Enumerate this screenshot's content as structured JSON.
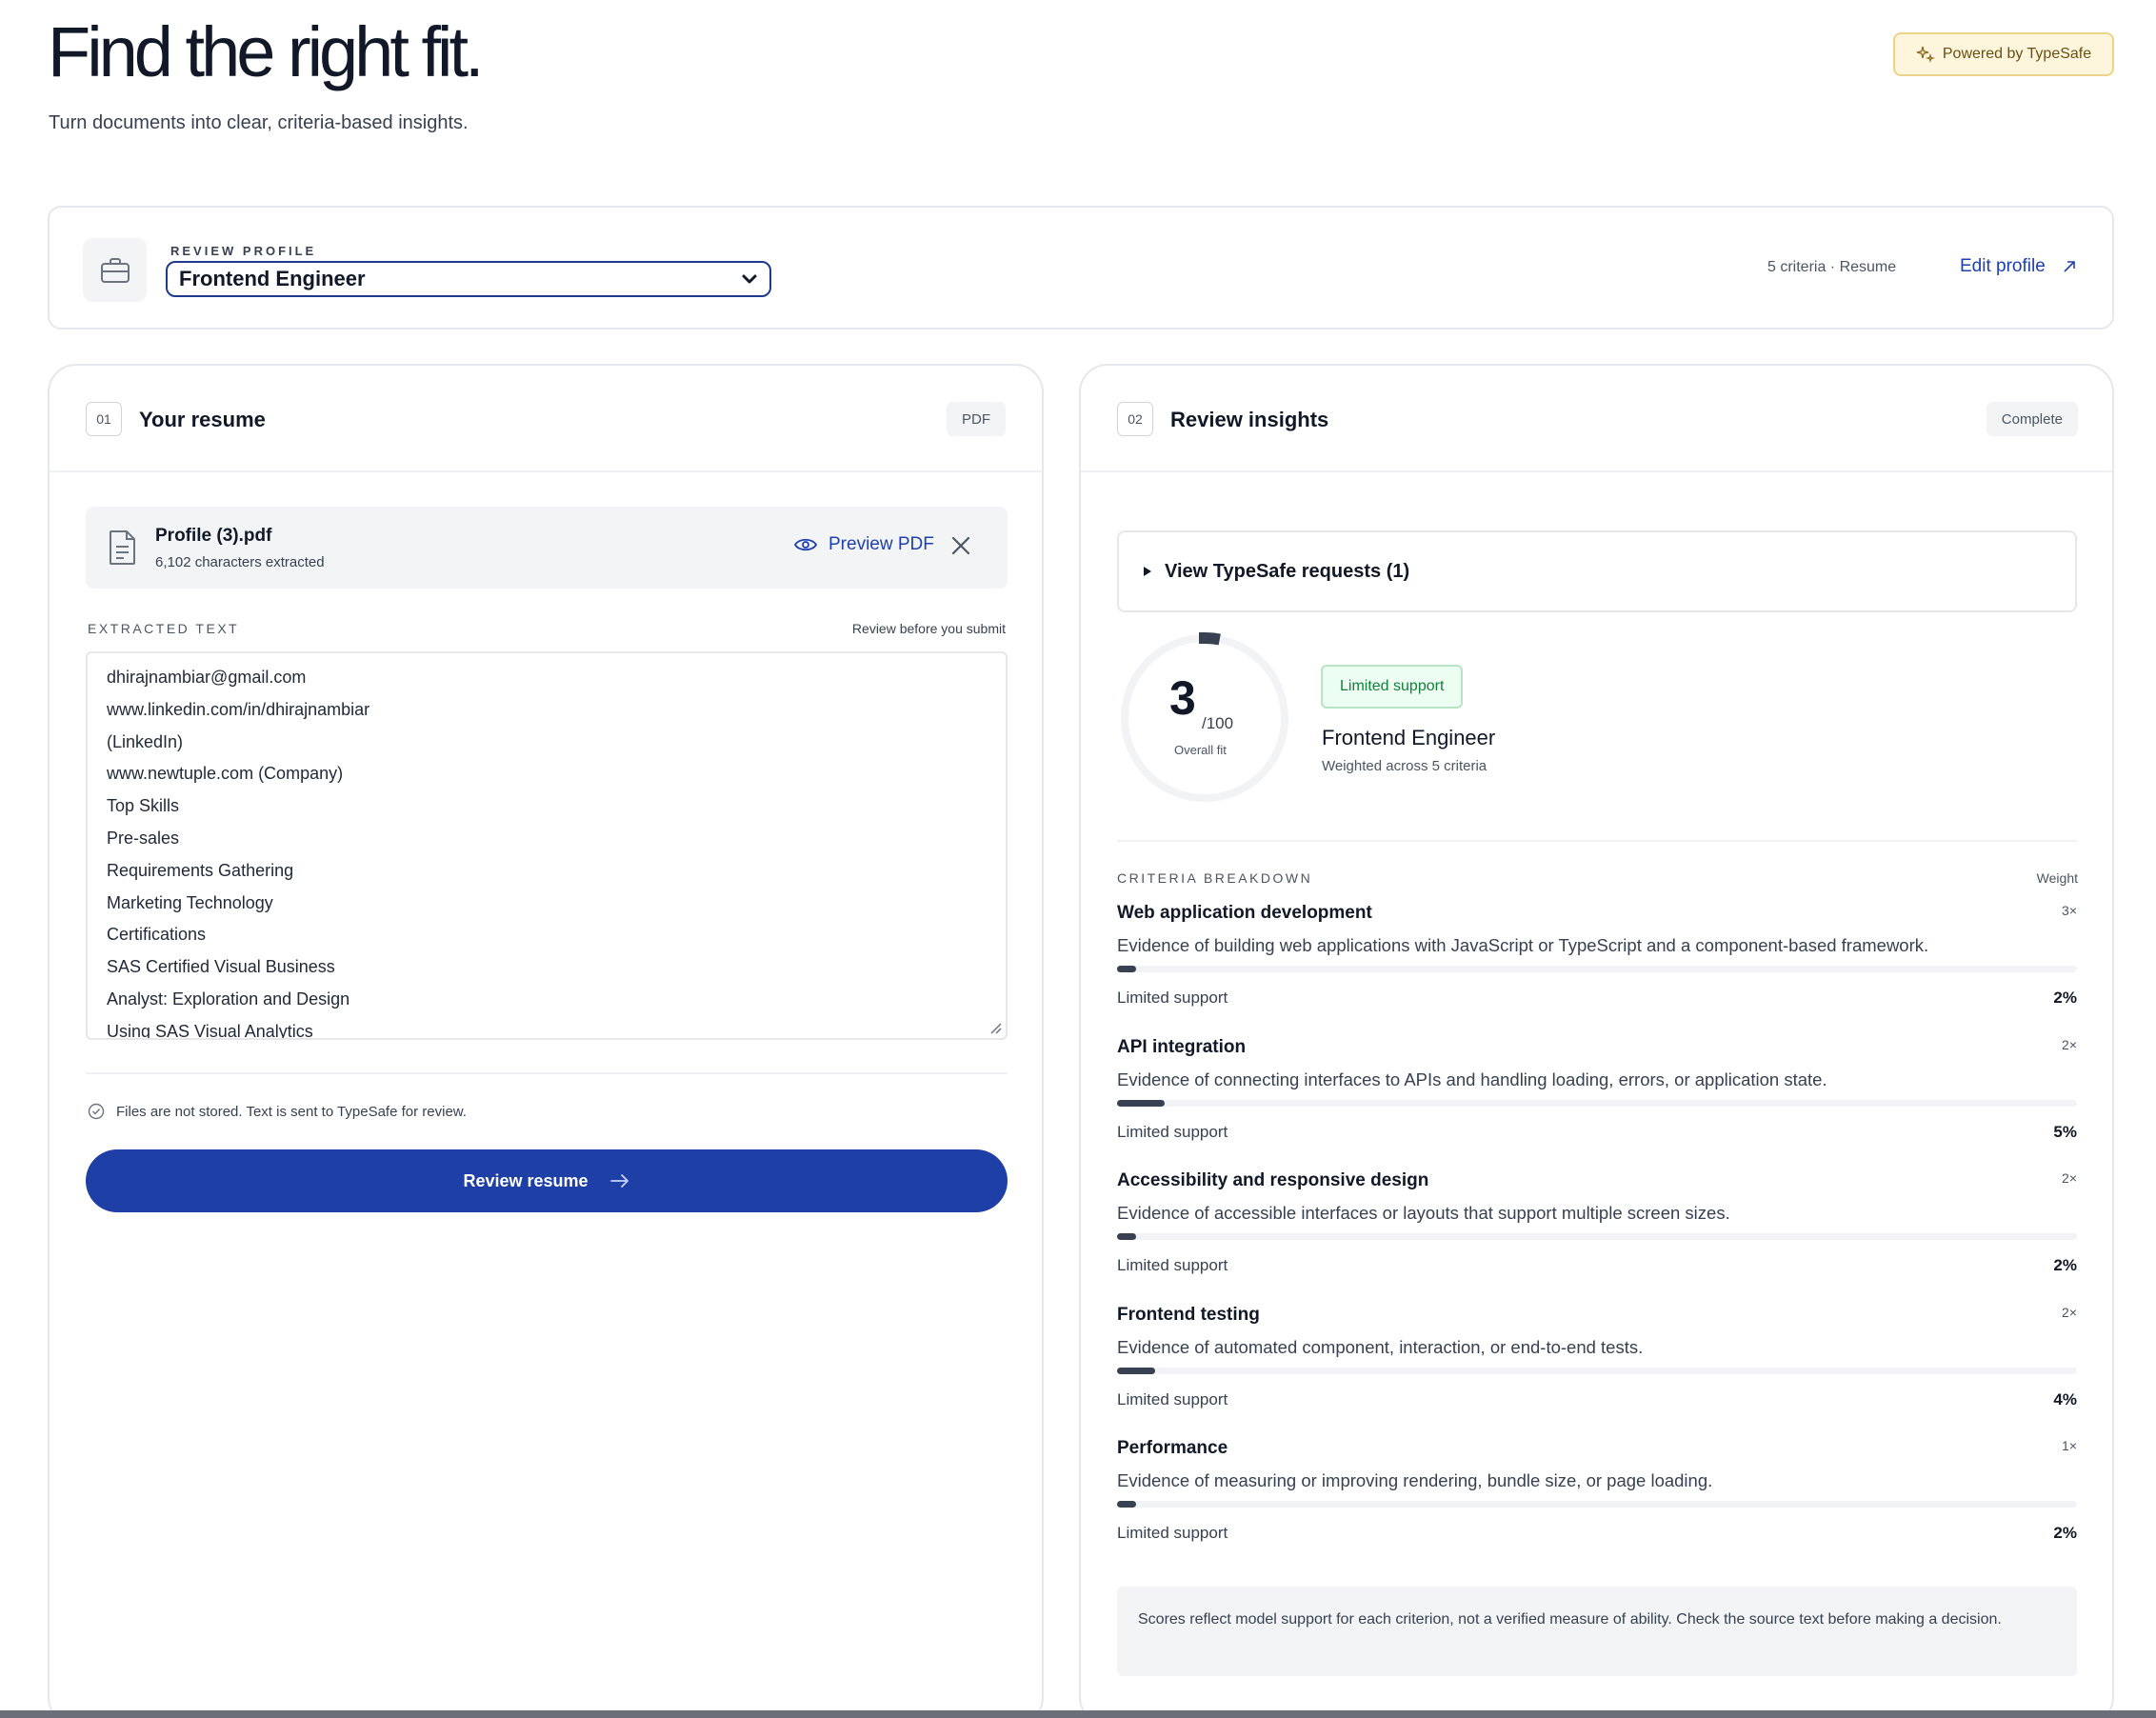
{
  "header": {
    "title": "Find the right fit.",
    "subtitle": "Turn documents into clear, criteria-based insights.",
    "powered_by": "Powered by TypeSafe"
  },
  "profile": {
    "label": "REVIEW PROFILE",
    "selected": "Frontend Engineer",
    "meta": "5 criteria · Resume",
    "edit_label": "Edit profile"
  },
  "resume_card": {
    "number": "01",
    "title": "Your resume",
    "tag": "PDF",
    "file": {
      "name": "Profile (3).pdf",
      "chars": "6,102 characters extracted",
      "preview_label": "Preview PDF"
    },
    "extracted_label": "EXTRACTED TEXT",
    "extracted_hint": "Review before you submit",
    "extracted_lines": [
      "dhirajnambiar@gmail.com",
      "www.linkedin.com/in/dhirajnambiar",
      "(LinkedIn)",
      "www.newtuple.com (Company)",
      "Top Skills",
      "Pre-sales",
      "Requirements Gathering",
      "Marketing Technology",
      "Certifications",
      "SAS Certified Visual Business",
      "Analyst: Exploration and Design",
      "Using SAS Visual Analytics"
    ],
    "note": "Files are not stored. Text is sent to TypeSafe for review.",
    "review_button": "Review resume"
  },
  "insights_card": {
    "number": "02",
    "title": "Review insights",
    "tag": "Complete",
    "requests_label": "View TypeSafe requests (1)",
    "score": {
      "value": "3",
      "out_of": "/100",
      "caption": "Overall fit",
      "fraction": 0.03
    },
    "badge": "Limited support",
    "role": "Frontend Engineer",
    "role_sub": "Weighted across 5 criteria",
    "breakdown_label": "CRITERIA BREAKDOWN",
    "weight_label": "Weight",
    "criteria": [
      {
        "name": "Web application development",
        "weight": "3×",
        "desc": "Evidence of building web applications with JavaScript or TypeScript and a component-based framework.",
        "support": "Limited support",
        "pct": "2%",
        "fraction": 0.02
      },
      {
        "name": "API integration",
        "weight": "2×",
        "desc": "Evidence of connecting interfaces to APIs and handling loading, errors, or application state.",
        "support": "Limited support",
        "pct": "5%",
        "fraction": 0.05
      },
      {
        "name": "Accessibility and responsive design",
        "weight": "2×",
        "desc": "Evidence of accessible interfaces or layouts that support multiple screen sizes.",
        "support": "Limited support",
        "pct": "2%",
        "fraction": 0.02
      },
      {
        "name": "Frontend testing",
        "weight": "2×",
        "desc": "Evidence of automated component, interaction, or end-to-end tests.",
        "support": "Limited support",
        "pct": "4%",
        "fraction": 0.04
      },
      {
        "name": "Performance",
        "weight": "1×",
        "desc": "Evidence of measuring or improving rendering, bundle size, or page loading.",
        "support": "Limited support",
        "pct": "2%",
        "fraction": 0.02
      }
    ],
    "disclaimer": "Scores reflect model support for each criterion, not a verified measure of ability. Check the source text before making a decision."
  },
  "colors": {
    "accent": "#1e40a6",
    "link": "#1e40af",
    "badge_green": "#15803d",
    "powered_bg": "#fdf6dc"
  }
}
